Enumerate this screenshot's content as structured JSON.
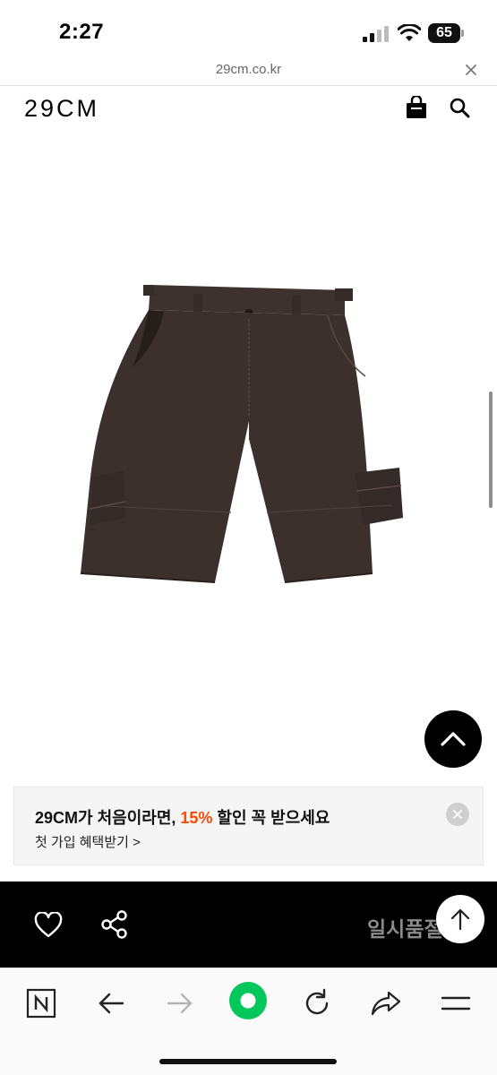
{
  "status_bar": {
    "time": "2:27",
    "battery": "65"
  },
  "browser": {
    "url": "29cm.co.kr"
  },
  "header": {
    "logo": "29CM",
    "icons": [
      "shopping-bag-icon",
      "search-icon"
    ]
  },
  "product": {
    "image": "brown-cargo-shorts",
    "image_color": "#3b302c"
  },
  "banner": {
    "title_prefix": "29CM가 처음이라면, ",
    "title_accent": "15%",
    "title_suffix": " 할인 꼭 받으세요",
    "subtitle": "첫 가입 혜택받기 >",
    "accent_color": "#ff4800"
  },
  "action_bar": {
    "status_label": "일시품절",
    "icons": [
      "heart-icon",
      "share-icon",
      "arrow-up-icon"
    ]
  },
  "toolbar": {
    "icons": [
      "naver-n-icon",
      "back-arrow-icon",
      "forward-arrow-icon",
      "green-home-icon",
      "reload-icon",
      "share-arrow-icon",
      "menu-icon"
    ],
    "brand_color": "#03c75a"
  }
}
